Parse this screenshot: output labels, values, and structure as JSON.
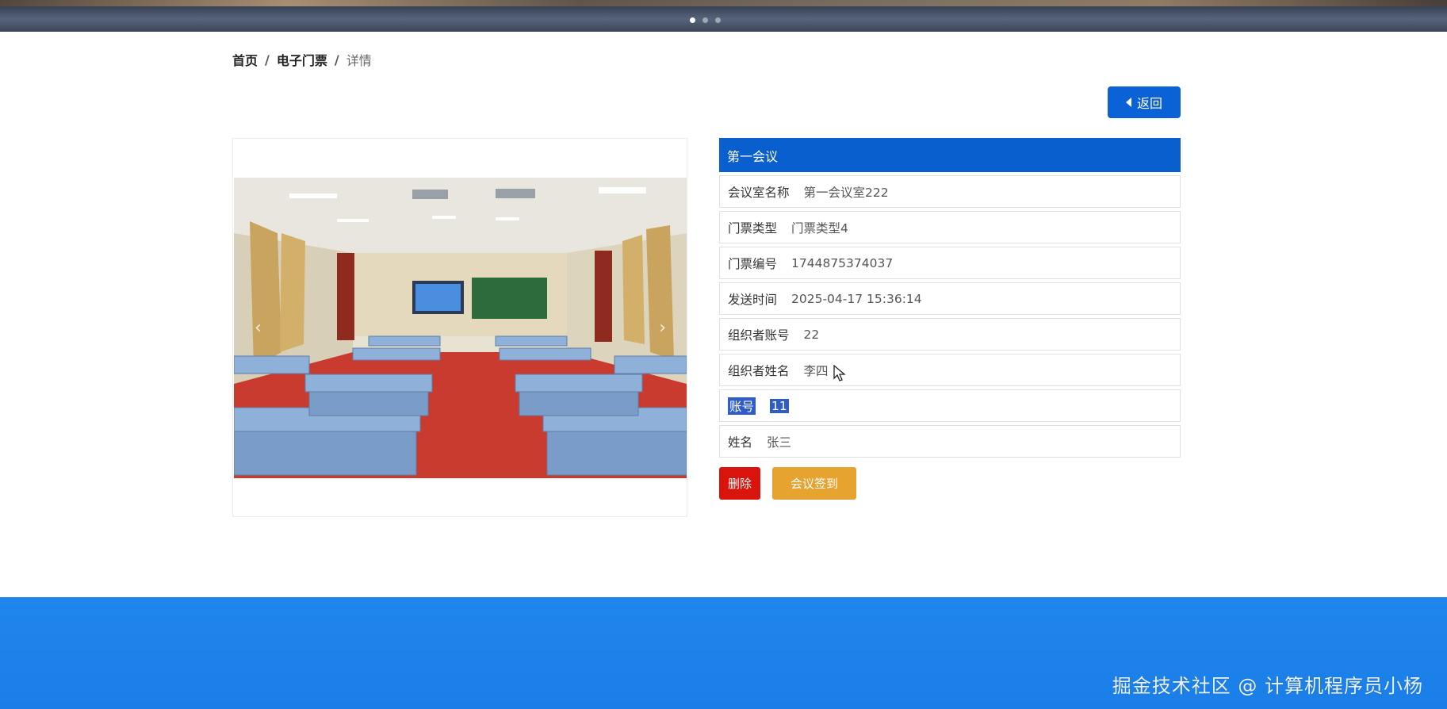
{
  "banner": {
    "slide_count": 3,
    "active_index": 0
  },
  "breadcrumb": {
    "home": "首页",
    "section": "电子门票",
    "current": "详情",
    "separator": "/"
  },
  "back_button": {
    "label": "返回",
    "icon": "caret-left-icon"
  },
  "gallery": {
    "prev_icon": "‹",
    "next_icon": "›"
  },
  "detail": {
    "title": "第一会议",
    "rows": [
      {
        "label": "会议室名称",
        "value": "第一会议室222"
      },
      {
        "label": "门票类型",
        "value": "门票类型4"
      },
      {
        "label": "门票编号",
        "value": "1744875374037"
      },
      {
        "label": "发送时间",
        "value": "2025-04-17 15:36:14"
      },
      {
        "label": "组织者账号",
        "value": "22"
      },
      {
        "label": "组织者姓名",
        "value": "李四"
      },
      {
        "label": "账号",
        "value": "11",
        "selected": true
      },
      {
        "label": "姓名",
        "value": "张三"
      }
    ]
  },
  "actions": {
    "delete": "删除",
    "sign_in": "会议签到"
  },
  "footer": {
    "watermark": "掘金技术社区 @ 计算机程序员小杨"
  },
  "colors": {
    "primary": "#0a62d6",
    "danger": "#d9140c",
    "warning": "#e6a330",
    "footer": "#1f86ec"
  }
}
